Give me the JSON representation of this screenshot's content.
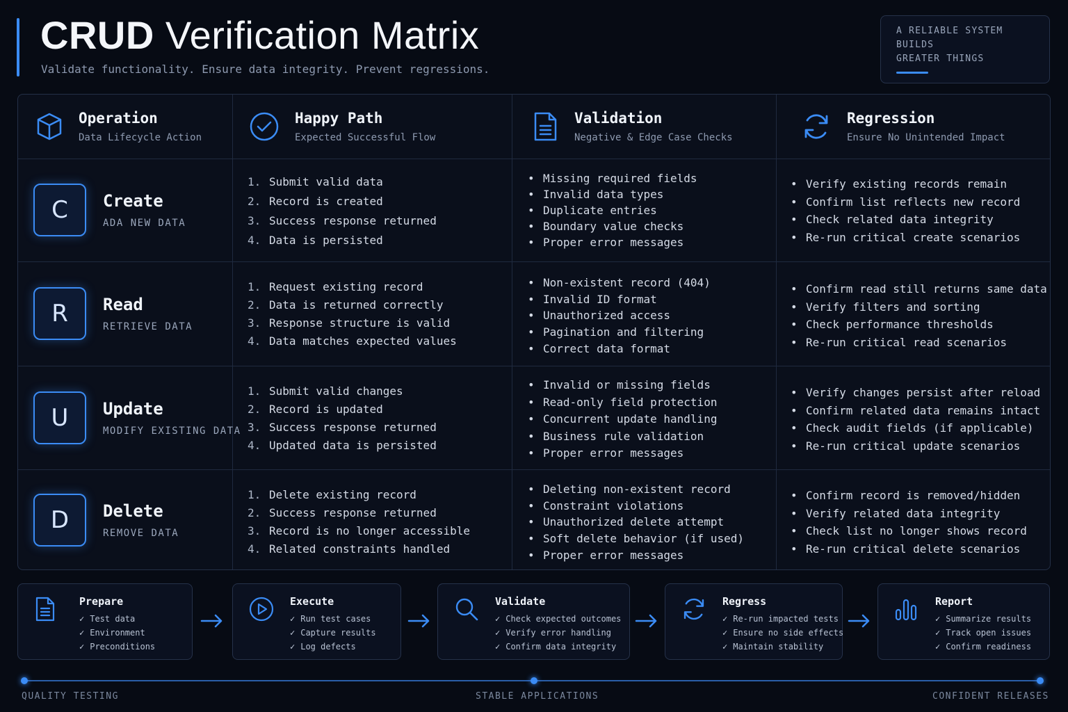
{
  "header": {
    "title_bold": "CRUD",
    "title_rest": "Verification Matrix",
    "subtitle": "Validate functionality. Ensure data integrity. Prevent regressions.",
    "tagline": [
      "A RELIABLE SYSTEM",
      "BUILDS",
      "GREATER THINGS"
    ],
    "accent_color": "#3b8cf5"
  },
  "columns": [
    {
      "name": "Operation",
      "sub": "Data Lifecycle Action",
      "icon": "cube-icon"
    },
    {
      "name": "Happy Path",
      "sub": "Expected Successful Flow",
      "icon": "check-circle-icon"
    },
    {
      "name": "Validation",
      "sub": "Negative & Edge Case Checks",
      "icon": "document-icon"
    },
    {
      "name": "Regression",
      "sub": "Ensure No Unintended Impact",
      "icon": "refresh-icon"
    }
  ],
  "rows": [
    {
      "letter": "C",
      "name": "Create",
      "sub": "ADA NEW DATA",
      "happy": [
        "1.",
        "Submit valid data",
        "2.",
        "Record is created",
        "3.",
        "Success response returned",
        "4.",
        "Data is persisted"
      ],
      "validation": [
        "Missing required fields",
        "Invalid data types",
        "Duplicate entries",
        "Boundary value checks",
        "Proper error messages"
      ],
      "regression": [
        "Verify existing records remain",
        "Confirm list reflects new record",
        "Check related data integrity",
        "Re-run critical create scenarios"
      ]
    },
    {
      "letter": "R",
      "name": "Read",
      "sub": "RETRIEVE DATA",
      "happy": [
        "1.",
        "Request existing record",
        "2.",
        "Data is returned correctly",
        "3.",
        "Response structure is valid",
        "4.",
        "Data matches expected values"
      ],
      "validation": [
        "Non-existent record (404)",
        "Invalid ID format",
        "Unauthorized access",
        "Pagination and filtering",
        "Correct data format"
      ],
      "regression": [
        "Confirm read still returns same data",
        "Verify filters and sorting",
        "Check performance thresholds",
        "Re-run critical read scenarios"
      ]
    },
    {
      "letter": "U",
      "name": "Update",
      "sub": "MODIFY EXISTING DATA",
      "happy": [
        "1.",
        "Submit valid changes",
        "2.",
        "Record is updated",
        "3.",
        "Success response returned",
        "4.",
        "Updated data is persisted"
      ],
      "validation": [
        "Invalid or missing fields",
        "Read-only field protection",
        "Concurrent update handling",
        "Business rule validation",
        "Proper error messages"
      ],
      "regression": [
        "Verify changes persist after reload",
        "Confirm related data remains intact",
        "Check audit fields (if applicable)",
        "Re-run critical update scenarios"
      ]
    },
    {
      "letter": "D",
      "name": "Delete",
      "sub": "REMOVE DATA",
      "happy": [
        "1.",
        "Delete existing record",
        "2.",
        "Success response returned",
        "3.",
        "Record is no longer accessible",
        "4.",
        "Related constraints handled"
      ],
      "validation": [
        "Deleting non-existent record",
        "Constraint violations",
        "Unauthorized delete attempt",
        "Soft delete behavior (if used)",
        "Proper error messages"
      ],
      "regression": [
        "Confirm record is removed/hidden",
        "Verify related data integrity",
        "Check list no longer shows record",
        "Re-run critical delete scenarios"
      ]
    }
  ],
  "workflow": [
    {
      "name": "Prepare",
      "icon": "document-icon",
      "items": [
        "Test data",
        "Environment",
        "Preconditions"
      ]
    },
    {
      "name": "Execute",
      "icon": "play-icon",
      "items": [
        "Run test cases",
        "Capture results",
        "Log defects"
      ]
    },
    {
      "name": "Validate",
      "icon": "search-icon",
      "items": [
        "Check expected outcomes",
        "Verify error handling",
        "Confirm data integrity"
      ]
    },
    {
      "name": "Regress",
      "icon": "refresh-icon",
      "items": [
        "Re-run impacted tests",
        "Ensure no side effects",
        "Maintain stability"
      ]
    },
    {
      "name": "Report",
      "icon": "bar-chart-icon",
      "items": [
        "Summarize results",
        "Track open issues",
        "Confirm readiness"
      ]
    }
  ],
  "timeline": {
    "labels": [
      "QUALITY TESTING",
      "STABLE APPLICATIONS",
      "CONFIDENT RELEASES"
    ]
  }
}
